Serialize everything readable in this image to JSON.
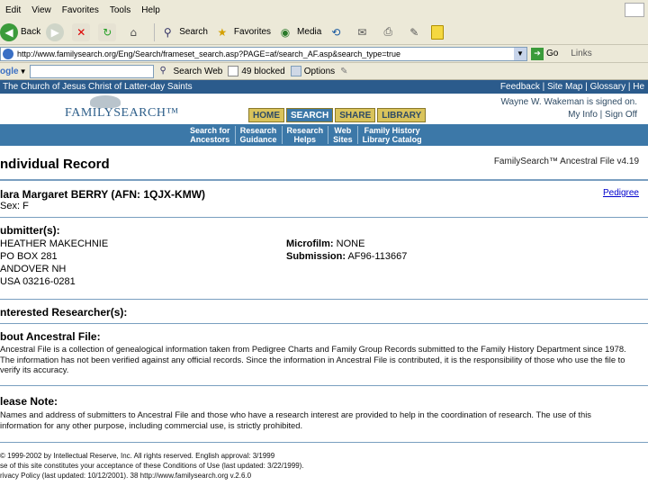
{
  "menu": {
    "items": [
      "Edit",
      "View",
      "Favorites",
      "Tools",
      "Help"
    ]
  },
  "toolbar": {
    "back_label": "Back",
    "search_label": "Search",
    "favorites_label": "Favorites",
    "media_label": "Media"
  },
  "address": {
    "url": "http://www.familysearch.org/Eng/Search/frameset_search.asp?PAGE=af/search_AF.asp&search_type=true",
    "go_label": "Go",
    "links_label": "Links"
  },
  "google_bar": {
    "logo": "ogle",
    "search_web_label": "Search Web",
    "blocked_label": "49 blocked",
    "options_label": "Options"
  },
  "site": {
    "church_title": "The Church of Jesus Christ of Latter-day Saints",
    "top_links": "Feedback | Site Map | Glossary | He",
    "logo_text": "FAMILYSEARCH™",
    "tabs": [
      {
        "label": "HOME",
        "active": false
      },
      {
        "label": "SEARCH",
        "active": true
      },
      {
        "label": "SHARE",
        "active": false
      },
      {
        "label": "LIBRARY",
        "active": false
      }
    ],
    "signed_in": "Wayne W. Wakeman is signed on.",
    "account_links": "My Info | Sign Off",
    "subnav": [
      {
        "line1": "Search for",
        "line2": "Ancestors"
      },
      {
        "line1": "Research",
        "line2": "Guidance"
      },
      {
        "line1": "Research",
        "line2": "Helps"
      },
      {
        "line1": "Web",
        "line2": "Sites"
      },
      {
        "line1": "Family History",
        "line2": "Library Catalog"
      }
    ]
  },
  "record": {
    "title": "ndividual Record",
    "source": "FamilySearch™ Ancestral File v4.19",
    "person": "lara Margaret BERRY (AFN: 1QJX-KMW)",
    "pedigree_link": "Pedigree",
    "sex": "Sex: F",
    "submitter_heading": "ubmitter(s):",
    "submitter_lines": [
      "HEATHER MAKECHNIE",
      "PO BOX 281",
      "ANDOVER NH",
      "USA 03216-0281"
    ],
    "microfilm_label": "Microfilm:",
    "microfilm_value": "NONE",
    "submission_label": "Submission:",
    "submission_value": "AF96-113667",
    "researchers_heading": "nterested Researcher(s):",
    "about_heading": "bout Ancestral File:",
    "about_text": "Ancestral File is a collection of genealogical information taken from Pedigree Charts and Family Group Records submitted to the Family History Department since 1978. The information has not been verified against any official records. Since the information in Ancestral File is contributed, it is the responsibility of those who use the file to verify its accuracy.",
    "note_heading": "lease Note:",
    "note_text": "Names and address of submitters to Ancestral File and those who have a research interest are provided to help in the coordination of research. The use of this information for any other purpose, including commercial use, is strictly prohibited."
  },
  "footer": {
    "line1": "© 1999-2002 by Intellectual Reserve, Inc. All rights reserved. English approval: 3/1999",
    "line2": "se of this site constitutes your acceptance of these Conditions of Use (last updated: 3/22/1999).",
    "line3": "rivacy Policy (last updated: 10/12/2001).   38   http://www.familysearch.org   v.2.6.0"
  }
}
